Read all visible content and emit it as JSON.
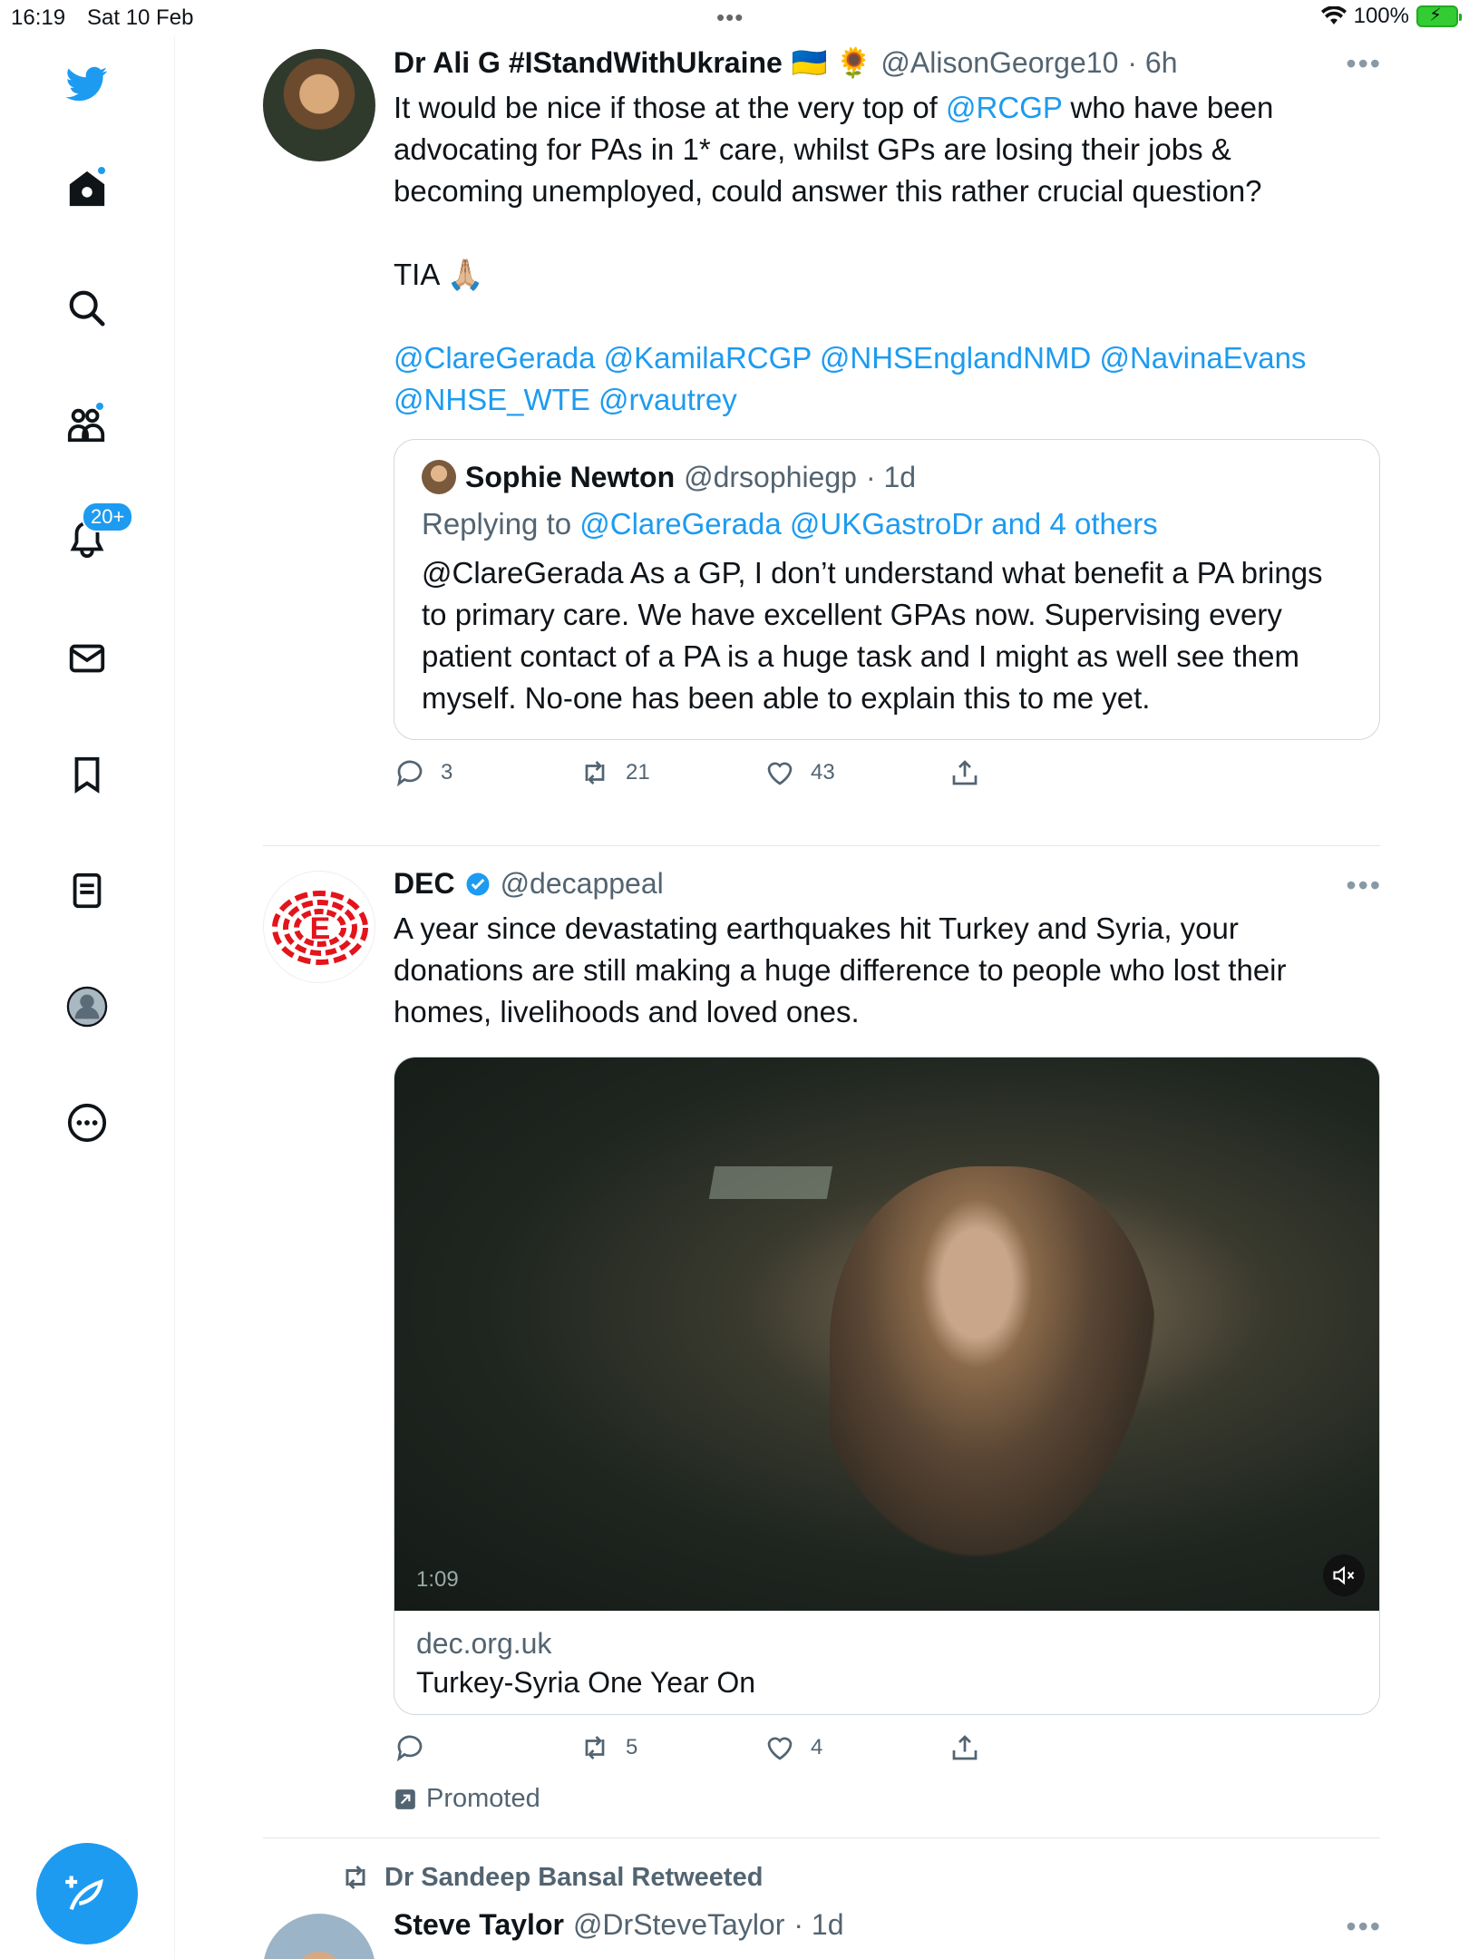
{
  "status_bar": {
    "time": "16:19",
    "date": "Sat 10 Feb",
    "battery": "100%"
  },
  "sidebar": {
    "notifications_badge": "20+"
  },
  "tweets": [
    {
      "name": "Dr Ali G #IStandWithUkraine",
      "flags": "🇺🇦 🌻",
      "handle": "@AlisonGeorge10",
      "time": "· 6h",
      "text_pre": "It would be nice if those at the very top of ",
      "mention": "@RCGP",
      "text_post": " who have been advocating for PAs in 1* care, whilst GPs are losing their jobs & becoming unemployed, could answer this rather crucial question?",
      "tia": "TIA 🙏🏼",
      "mentions_line1": "@ClareGerada @KamilaRCGP @NHSEnglandNMD @NavinaEvans",
      "mentions_line2": "@NHSE_WTE @rvautrey",
      "quote": {
        "name": "Sophie Newton",
        "handle": "@drsophiegp",
        "time": "· 1d",
        "replying_prefix": "Replying to ",
        "replying_to": "@ClareGerada @UKGastroDr and 4 others",
        "text": "@ClareGerada As a GP, I don’t understand what benefit a PA brings to primary care. We have excellent GPAs now. Supervising every patient contact of a PA is a huge task and I might as well see them myself. No-one has been able to explain this to me yet."
      },
      "replies": "3",
      "retweets": "21",
      "likes": "43"
    },
    {
      "name": "DEC",
      "handle": "@decappeal",
      "text": "A year since devastating earthquakes hit Turkey and Syria, your donations are still making a huge difference to people who lost their homes, livelihoods and loved ones.",
      "video_duration": "1:09",
      "card_domain": "dec.org.uk",
      "card_title": "Turkey-Syria One Year On",
      "replies": "",
      "retweets": "5",
      "likes": "4",
      "promoted": "Promoted"
    },
    {
      "retweeted_by": "Dr Sandeep Bansal Retweeted",
      "name": "Steve Taylor",
      "handle": "@DrSteveTaylor",
      "time": "· 1d"
    }
  ]
}
